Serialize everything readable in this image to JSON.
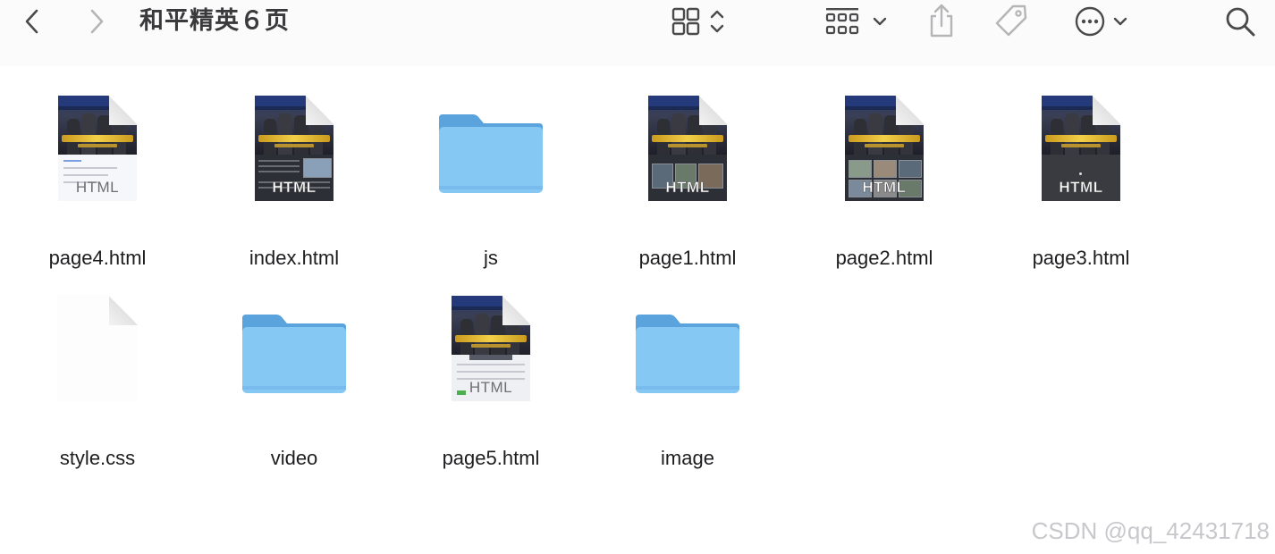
{
  "window": {
    "title": "和平精英６页"
  },
  "toolbar": {
    "back": "chevron-left-icon",
    "forward": "chevron-right-icon",
    "view": "icon-grid-icon",
    "group": "group-icon",
    "share": "share-icon",
    "tag": "tag-icon",
    "more": "ellipsis-icon",
    "search": "search-icon"
  },
  "files": [
    {
      "name": "page4.html",
      "kind": "html",
      "badge": "HTML",
      "preview": "white"
    },
    {
      "name": "index.html",
      "kind": "html",
      "badge": "HTML",
      "preview": "article"
    },
    {
      "name": "js",
      "kind": "folder"
    },
    {
      "name": "page1.html",
      "kind": "html",
      "badge": "HTML",
      "preview": "gallery"
    },
    {
      "name": "page2.html",
      "kind": "html",
      "badge": "HTML",
      "preview": "gallery2"
    },
    {
      "name": "page3.html",
      "kind": "html",
      "badge": "HTML",
      "preview": "dark"
    },
    {
      "name": "style.css",
      "kind": "css"
    },
    {
      "name": "video",
      "kind": "folder"
    },
    {
      "name": "page5.html",
      "kind": "html",
      "badge": "HTML",
      "preview": "form"
    },
    {
      "name": "image",
      "kind": "folder"
    }
  ],
  "watermark": "CSDN @qq_42431718",
  "colors": {
    "folder_front": "#86c8f4",
    "folder_back": "#5aa3dc",
    "toolbar_bg": "#fbfbfb"
  }
}
